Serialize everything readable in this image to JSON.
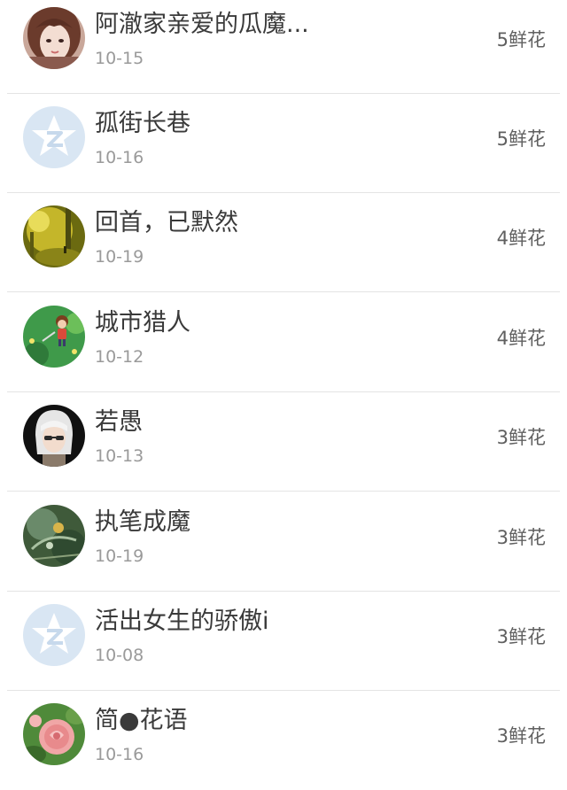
{
  "entries": [
    {
      "name": "阿澈家亲爱的瓜魔...",
      "date": "10-15",
      "flowers": "5鲜花",
      "avatar_icon": "girl-portrait-avatar-icon"
    },
    {
      "name": "孤街长巷",
      "date": "10-16",
      "flowers": "5鲜花",
      "avatar_icon": "qzone-default-avatar-icon"
    },
    {
      "name": "回首，已默然",
      "date": "10-19",
      "flowers": "4鲜花",
      "avatar_icon": "golden-forest-avatar-icon"
    },
    {
      "name": "城市猎人",
      "date": "10-12",
      "flowers": "4鲜花",
      "avatar_icon": "game-character-avatar-icon"
    },
    {
      "name": "若愚",
      "date": "10-13",
      "flowers": "3鲜花",
      "avatar_icon": "silver-hair-character-avatar-icon"
    },
    {
      "name": "执笔成魔",
      "date": "10-19",
      "flowers": "3鲜花",
      "avatar_icon": "fantasy-scene-avatar-icon"
    },
    {
      "name": "活出女生的骄傲i",
      "date": "10-08",
      "flowers": "3鲜花",
      "avatar_icon": "qzone-default-avatar-icon"
    },
    {
      "name": "简●花语",
      "date": "10-16",
      "flowers": "3鲜花",
      "avatar_icon": "pink-rose-avatar-icon"
    }
  ],
  "colors": {
    "name_text": "#3a3a3a",
    "date_text": "#9a9a9a",
    "flower_text": "#606060",
    "divider": "#e4e4e4",
    "default_avatar_bg": "#d9e6f3"
  }
}
